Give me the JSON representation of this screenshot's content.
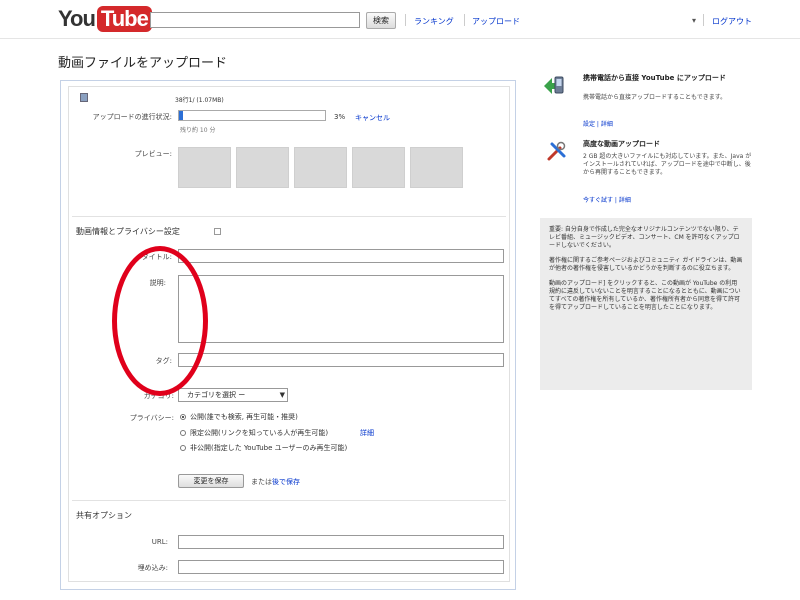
{
  "header": {
    "logo_you": "You",
    "logo_tube": "Tube",
    "search_button": "検索",
    "nav_ranking": "ランキング",
    "nav_upload": "アップロード",
    "user_menu_arrow": "▾",
    "logout": "ログアウト"
  },
  "page": {
    "title": "動画ファイルをアップロード"
  },
  "upload": {
    "file_name": "38行1/ (1.07MB)",
    "progress_label": "アップロードの進行状況:",
    "progress_percent": "3%",
    "progress_fraction": 0.03,
    "cancel": "キャンセル",
    "remaining": "残り約 10 分",
    "preview_label": "プレビュー:",
    "thumbnails": [
      "",
      "",
      "",
      "",
      ""
    ]
  },
  "video_info": {
    "heading": "動画情報とプライバシー設定",
    "title_label": "タイトル:",
    "description_label": "説明:",
    "tags_label": "タグ:",
    "category_label": "カテゴリ:",
    "category_value": "カテゴリを選択 ー",
    "privacy_label": "プライバシー:",
    "privacy_options": [
      {
        "text": "公開(誰でも検索, 再生可能・推奨)",
        "selected": true,
        "link": ""
      },
      {
        "text": "限定公開(リンクを知っている人が再生可能)",
        "selected": false,
        "link": "詳細"
      },
      {
        "text": "非公開(指定した YouTube ユーザーのみ再生可能)",
        "selected": false,
        "link": ""
      }
    ],
    "save_button": "変更を保存",
    "or_text": "または",
    "skip_link": "後で保存"
  },
  "share": {
    "heading": "共有オプション",
    "url_label": "URL:",
    "embed_label": "埋め込み:"
  },
  "promos": [
    {
      "title": "携帯電話から直接 YouTube にアップロード",
      "body": "携帯電話から直接アップロードすることもできます。",
      "link": "設定 | 詳細"
    },
    {
      "title": "高度な動画アップロード",
      "body": "2 GB 超の大きいファイルにも対応しています。また、Java がインストールされていれば、アップロードを途中で中断し、後から再開することもできます。",
      "link": "今すぐ試す | 詳細"
    }
  ],
  "notice": {
    "p1": "重要: 自分自身で作成した完全なオリジナルコンテンツでない限り、テレビ番組、ミュージックビデオ、コンサート、CM を許可なくアップロードしないでください。",
    "p2": "著作権に関するご参考ページおよびコミュニティ ガイドラインは、動画が他者の著作権を侵害しているかどうかを判断するのに役立ちます。",
    "p3": "動画のアップロード] をクリックすると、この動画が YouTube の利用規約に違反していないことを明言することになるとともに、動画についてすべての著作権を所有しているか、著作権所有者から同意を得て許可を得てアップロードしていることを明言したことになります。"
  },
  "colors": {
    "brand_red": "#d4292b",
    "link_blue": "#0033cc",
    "annotation_red": "#e0001b"
  }
}
